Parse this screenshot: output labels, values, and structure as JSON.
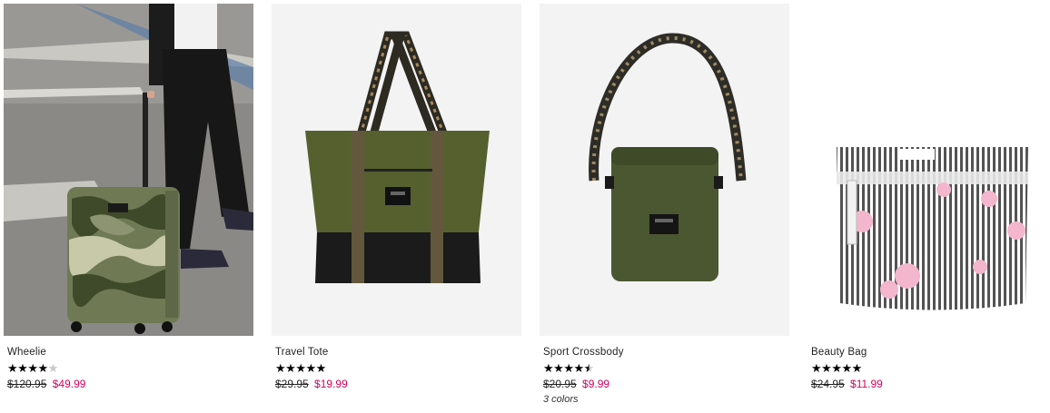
{
  "products": [
    {
      "name": "Wheelie",
      "rating": 4,
      "rating_max": 5,
      "original_price": "$120.95",
      "sale_price": "$49.99",
      "colors_text": ""
    },
    {
      "name": "Travel Tote",
      "rating": 5,
      "rating_max": 5,
      "original_price": "$29.95",
      "sale_price": "$19.99",
      "colors_text": ""
    },
    {
      "name": "Sport Crossbody",
      "rating": 4.5,
      "rating_max": 5,
      "original_price": "$20.95",
      "sale_price": "$9.99",
      "colors_text": "3 colors"
    },
    {
      "name": "Beauty Bag",
      "rating": 5,
      "rating_max": 5,
      "original_price": "$24.95",
      "sale_price": "$11.99",
      "colors_text": ""
    }
  ],
  "colors": {
    "sale_price": "#d6005c",
    "olive": "#4f5a2d",
    "camo_dark": "#3f4a2a"
  }
}
